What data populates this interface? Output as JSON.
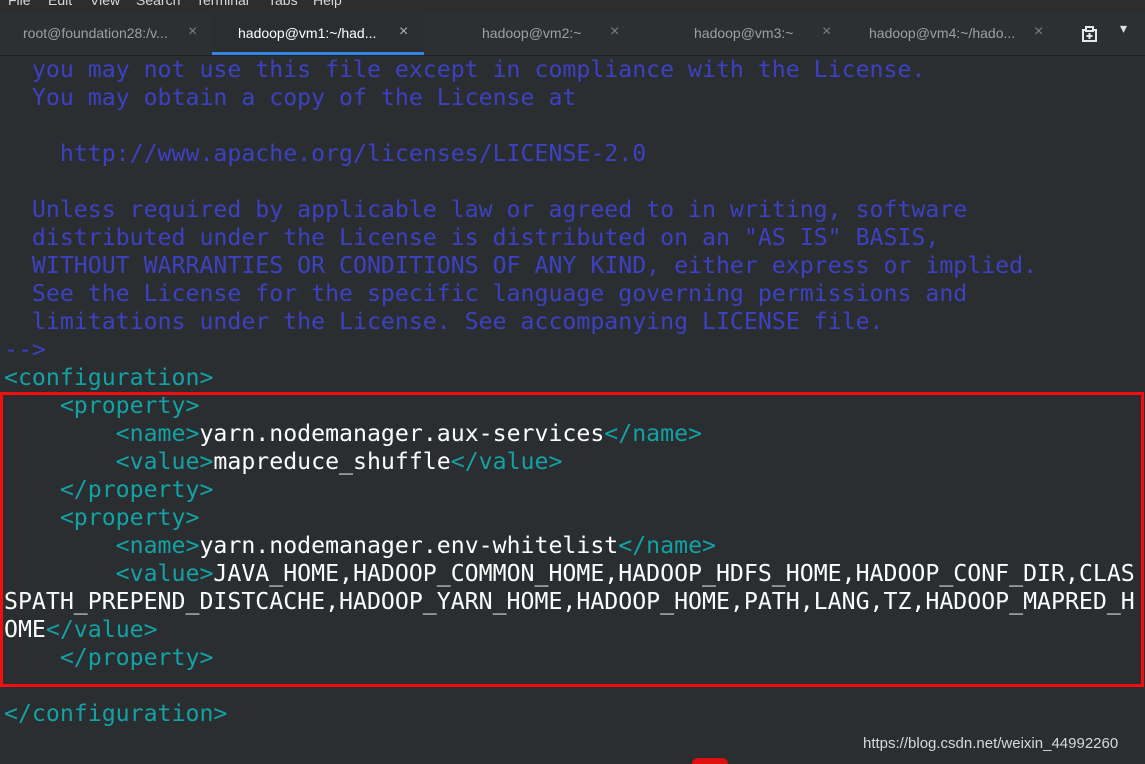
{
  "menubar": {
    "items": [
      "File",
      "Edit",
      "View",
      "Search",
      "Terminal",
      "Tabs",
      "Help"
    ]
  },
  "tabs": [
    {
      "title": "root@foundation28:/v...",
      "close": "×",
      "active": false
    },
    {
      "title": "hadoop@vm1:~/had...",
      "close": "×",
      "active": true
    },
    {
      "title": "hadoop@vm2:~",
      "close": "×",
      "active": false
    },
    {
      "title": "hadoop@vm3:~",
      "close": "×",
      "active": false
    },
    {
      "title": "hadoop@vm4:~/hado...",
      "close": "×",
      "active": false
    }
  ],
  "tab_menu_icon": "▾",
  "icons": {
    "new_tab": "new-tab-icon",
    "tab_menu": "chevron-down-icon"
  },
  "colors": {
    "comment": "#3c41c1",
    "tag": "#13a2a4",
    "text": "#ffffff",
    "background": "#2b2e30",
    "highlight_box": "#f20e0e"
  },
  "terminal": {
    "lines": [
      {
        "parts": [
          {
            "c": "cm",
            "t": "  you may not use this file except in compliance with the License."
          }
        ]
      },
      {
        "parts": [
          {
            "c": "cm",
            "t": "  You may obtain a copy of the License at"
          }
        ]
      },
      {
        "parts": [
          {
            "c": "cm",
            "t": ""
          }
        ]
      },
      {
        "parts": [
          {
            "c": "cm",
            "t": "    http://www.apache.org/licenses/LICENSE-2.0"
          }
        ]
      },
      {
        "parts": [
          {
            "c": "cm",
            "t": ""
          }
        ]
      },
      {
        "parts": [
          {
            "c": "cm",
            "t": "  Unless required by applicable law or agreed to in writing, software"
          }
        ]
      },
      {
        "parts": [
          {
            "c": "cm",
            "t": "  distributed under the License is distributed on an \"AS IS\" BASIS,"
          }
        ]
      },
      {
        "parts": [
          {
            "c": "cm",
            "t": "  WITHOUT WARRANTIES OR CONDITIONS OF ANY KIND, either express or implied."
          }
        ]
      },
      {
        "parts": [
          {
            "c": "cm",
            "t": "  See the License for the specific language governing permissions and"
          }
        ]
      },
      {
        "parts": [
          {
            "c": "cm",
            "t": "  limitations under the License. See accompanying LICENSE file."
          }
        ]
      },
      {
        "parts": [
          {
            "c": "cm",
            "t": "-->"
          }
        ]
      },
      {
        "parts": [
          {
            "c": "tg",
            "t": "<configuration>"
          }
        ]
      },
      {
        "parts": [
          {
            "c": "tg",
            "t": "    <property>"
          }
        ]
      },
      {
        "parts": [
          {
            "c": "tg",
            "t": "        <name>"
          },
          {
            "c": "tx",
            "t": "yarn.nodemanager.aux-services"
          },
          {
            "c": "tg",
            "t": "</name>"
          }
        ]
      },
      {
        "parts": [
          {
            "c": "tg",
            "t": "        <value>"
          },
          {
            "c": "tx",
            "t": "mapreduce_shuffle"
          },
          {
            "c": "tg",
            "t": "</value>"
          }
        ]
      },
      {
        "parts": [
          {
            "c": "tg",
            "t": "    </property>"
          }
        ]
      },
      {
        "parts": [
          {
            "c": "tg",
            "t": "    <property>"
          }
        ]
      },
      {
        "parts": [
          {
            "c": "tg",
            "t": "        <name>"
          },
          {
            "c": "tx",
            "t": "yarn.nodemanager.env-whitelist"
          },
          {
            "c": "tg",
            "t": "</name>"
          }
        ]
      },
      {
        "parts": [
          {
            "c": "tg",
            "t": "        <value>"
          },
          {
            "c": "tx",
            "t": "JAVA_HOME,HADOOP_COMMON_HOME,HADOOP_HDFS_HOME,HADOOP_CONF_DIR,CLAS"
          }
        ]
      },
      {
        "parts": [
          {
            "c": "tx",
            "t": "SPATH_PREPEND_DISTCACHE,HADOOP_YARN_HOME,HADOOP_HOME,PATH,LANG,TZ,HADOOP_MAPRED_H"
          }
        ]
      },
      {
        "parts": [
          {
            "c": "tx",
            "t": "OME"
          },
          {
            "c": "tg",
            "t": "</value>"
          }
        ]
      },
      {
        "parts": [
          {
            "c": "tg",
            "t": "    </property>"
          }
        ]
      },
      {
        "parts": [
          {
            "c": "tg",
            "t": ""
          }
        ]
      },
      {
        "parts": [
          {
            "c": "tg",
            "t": "</configuration>"
          }
        ]
      }
    ]
  },
  "watermark": "https://blog.csdn.net/weixin_44992260"
}
